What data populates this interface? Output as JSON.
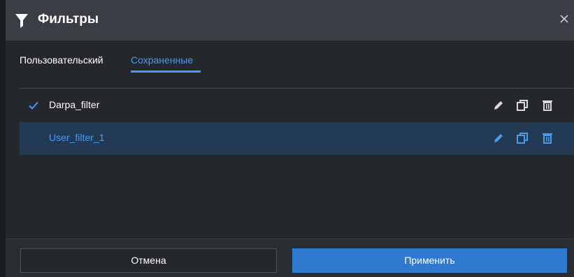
{
  "dialog": {
    "title": "Фильтры",
    "icons": {
      "header": "filter-icon",
      "close": "close-icon"
    }
  },
  "tabs": [
    {
      "label": "Пользовательский",
      "active": false
    },
    {
      "label": "Сохраненные",
      "active": true
    }
  ],
  "filters": [
    {
      "name": "Darpa_filter",
      "checked": true,
      "selected": false
    },
    {
      "name": "User_filter_1",
      "checked": false,
      "selected": true
    }
  ],
  "actions": {
    "icons": [
      "edit-icon",
      "copy-icon",
      "delete-icon"
    ]
  },
  "footer": {
    "cancel_label": "Отмена",
    "apply_label": "Применить"
  },
  "colors": {
    "accent": "#4a9bf0",
    "primary_button": "#2f7ad0",
    "header_bg": "#3a3d43",
    "panel_bg": "#24272c",
    "selected_row": "#233a55"
  }
}
